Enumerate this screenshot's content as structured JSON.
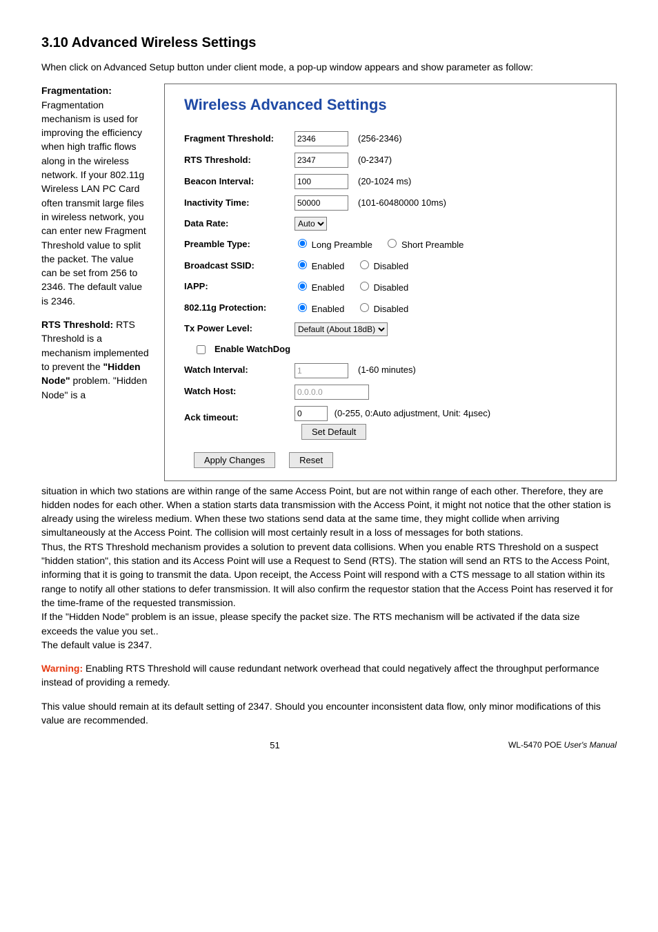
{
  "heading": "3.10 Advanced Wireless Settings",
  "intro": "When click on Advanced Setup button under client mode, a pop-up window appears and show parameter as follow:",
  "left_text": {
    "frag_heading": "Fragmentation:",
    "frag_body": "Fragmentation mechanism is used for improving the efficiency when high traffic flows along in the wireless network. If your 802.11g Wireless LAN PC Card often transmit large files in wireless network, you can enter new Fragment Threshold value to split the packet. The value can be set from 256 to 2346. The default value is 2346.",
    "rts_heading_strong": "RTS Threshold: ",
    "rts_heading_tail": "RTS Threshold is a mechanism implemented to prevent the ",
    "hidden_node_strong": "\"Hidden Node\"",
    "rts_heading_tail2": " problem. \"Hidden Node\" is a"
  },
  "panel": {
    "title": "Wireless Advanced Settings",
    "fragment": {
      "label": "Fragment Threshold:",
      "value": "2346",
      "hint": "(256-2346)"
    },
    "rts": {
      "label": "RTS Threshold:",
      "value": "2347",
      "hint": "(0-2347)"
    },
    "beacon": {
      "label": "Beacon Interval:",
      "value": "100",
      "hint": "(20-1024 ms)"
    },
    "inactivity": {
      "label": "Inactivity Time:",
      "value": "50000",
      "hint": "(101-60480000 10ms)"
    },
    "data_rate": {
      "label": "Data Rate:",
      "value": "Auto"
    },
    "preamble": {
      "label": "Preamble Type:",
      "opt1": "Long Preamble",
      "opt2": "Short Preamble"
    },
    "broadcast": {
      "label": "Broadcast SSID:",
      "opt1": "Enabled",
      "opt2": "Disabled"
    },
    "iapp": {
      "label": "IAPP:",
      "opt1": "Enabled",
      "opt2": "Disabled"
    },
    "protection": {
      "label": "802.11g Protection:",
      "opt1": "Enabled",
      "opt2": "Disabled"
    },
    "tx_power": {
      "label": "Tx Power Level:",
      "value": "Default (About 18dB)"
    },
    "watchdog": {
      "label": "Enable WatchDog"
    },
    "watch_interval": {
      "label": "Watch Interval:",
      "value": "1",
      "hint": "(1-60 minutes)"
    },
    "watch_host": {
      "label": "Watch Host:",
      "value": "0.0.0.0"
    },
    "ack": {
      "label": "Ack timeout:",
      "value": "0",
      "hint": "(0-255, 0:Auto adjustment, Unit: 4µsec)",
      "btn": "Set Default"
    },
    "apply_btn": "Apply Changes",
    "reset_btn": "Reset"
  },
  "body_after": {
    "p1": "situation in which two stations are within range of the same Access Point, but are not within range of each other. Therefore, they are hidden nodes for each other. When a station starts data transmission with the Access Point, it might not notice that the other station is already using the wireless medium. When these two stations send data at the same time, they might collide when arriving simultaneously at the Access Point. The collision will most certainly result in a loss of messages for both stations.",
    "p2": "Thus, the RTS Threshold mechanism provides a solution to prevent data collisions. When you enable RTS Threshold on a suspect \"hidden station\", this station and its Access Point will use a Request to Send (RTS). The station will send an RTS to the Access Point, informing that it is going to transmit the data. Upon receipt, the Access Point will respond with a CTS message to all station within its range to notify all other stations to defer transmission. It will also confirm the requestor station that the Access Point has reserved it for the time-frame of the requested transmission.",
    "p3": "If the \"Hidden Node\" problem is an issue, please specify the packet size. The RTS mechanism will be activated if the data size exceeds the value you set..",
    "p4": "The default value is 2347.",
    "warn_label": "Warning:",
    "warn_text": " Enabling RTS Threshold will cause redundant network overhead that could negatively affect the throughput performance instead of providing a remedy.",
    "p5": "This value should remain at its default setting of 2347. Should you encounter inconsistent data flow, only minor modifications of this value are recommended."
  },
  "footer": {
    "page": "51",
    "manual_prefix": "WL-5470 POE ",
    "manual_italic": "User's Manual"
  }
}
